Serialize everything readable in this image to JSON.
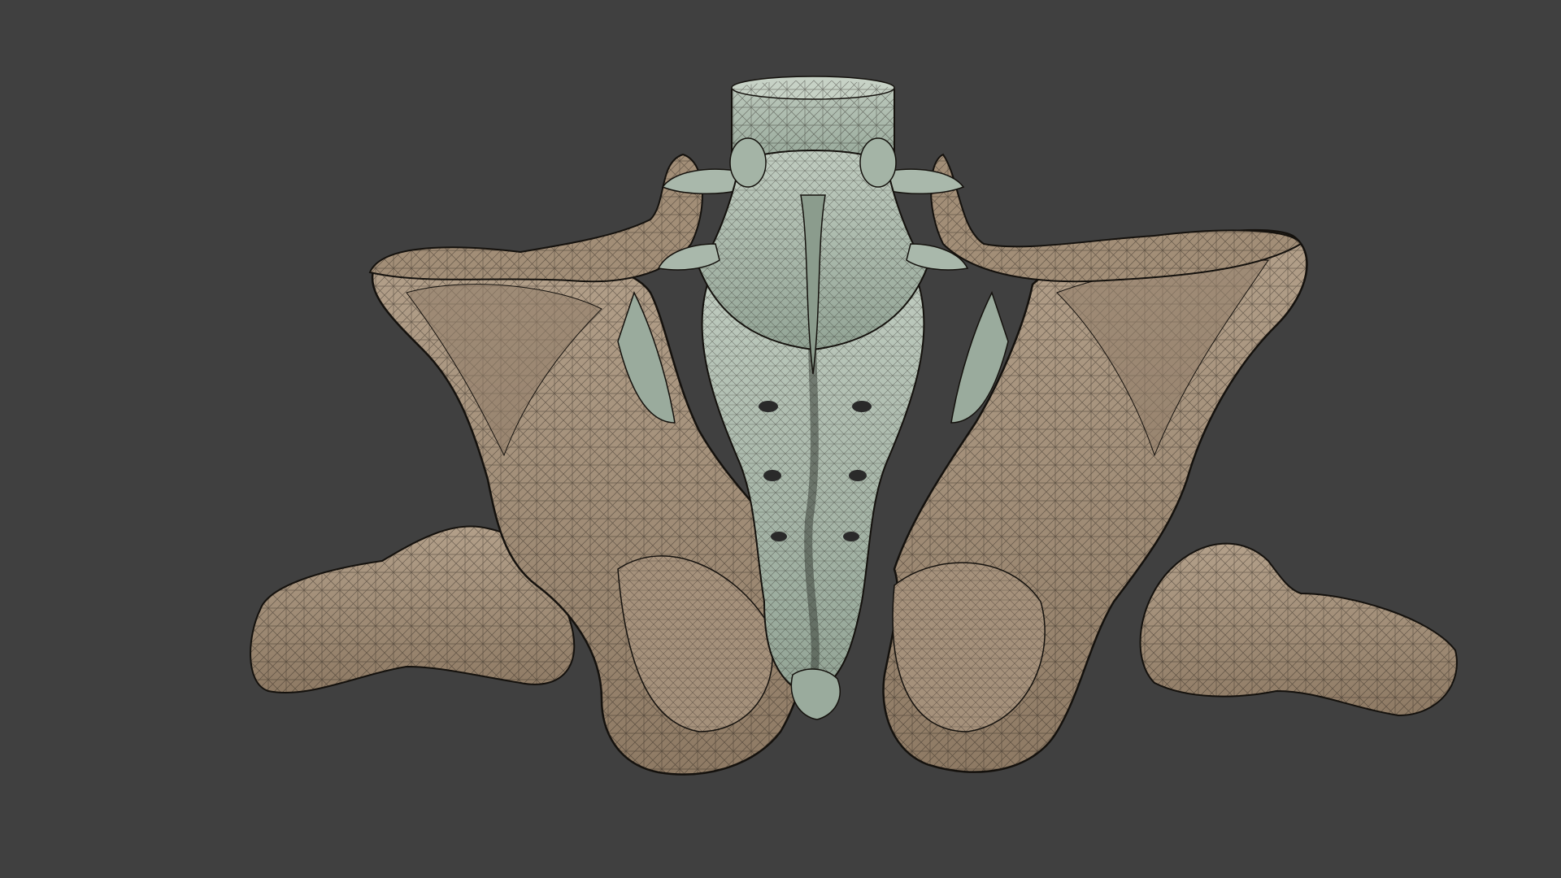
{
  "viewport": {
    "background_color": "#404040",
    "shading": "solid-with-wireframe-overlay",
    "view": "posterior"
  },
  "model": {
    "parts": [
      {
        "name": "lumbar-vertebra",
        "color": "#a9b8ab"
      },
      {
        "name": "sacrum",
        "color": "#a9b8ab"
      },
      {
        "name": "coccyx",
        "color": "#a9b8ab"
      },
      {
        "name": "left-hip-bone",
        "color": "#a28e77"
      },
      {
        "name": "right-hip-bone",
        "color": "#a28e77"
      },
      {
        "name": "left-femur-head-neck",
        "color": "#a28e77"
      },
      {
        "name": "right-femur-head-neck",
        "color": "#a28e77"
      }
    ],
    "wireframe_color": "#1a1612"
  }
}
